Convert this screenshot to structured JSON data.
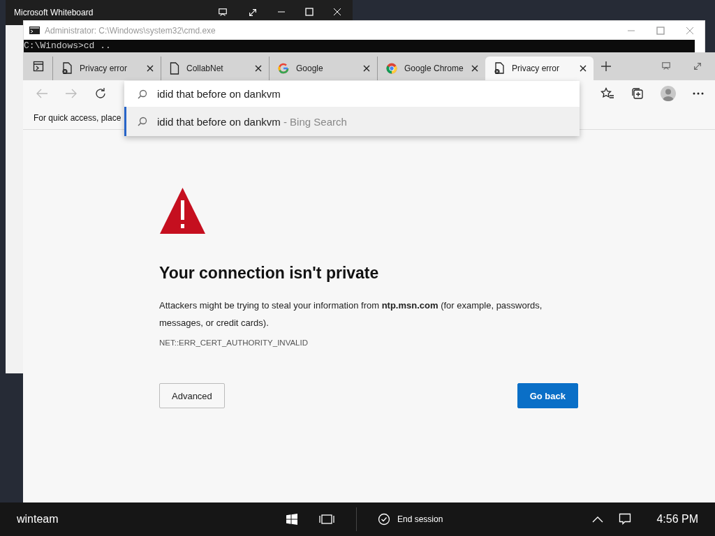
{
  "whiteboard": {
    "title": "Microsoft Whiteboard"
  },
  "cmd": {
    "title": "Administrator: C:\\Windows\\system32\\cmd.exe",
    "lines": [
      "C:\\Windows>cd .."
    ]
  },
  "browser": {
    "tabs": [
      {
        "title": "Privacy error",
        "kind": "error",
        "selected": false
      },
      {
        "title": "CollabNet",
        "kind": "page",
        "selected": false
      },
      {
        "title": "Google",
        "kind": "google",
        "selected": false
      },
      {
        "title": "Google Chrome",
        "kind": "chrome",
        "selected": false
      },
      {
        "title": "Privacy error",
        "kind": "error",
        "selected": true
      }
    ],
    "address": {
      "value": "idid that before on dankvm"
    },
    "suggestions": [
      {
        "query": "idid that before on dankvm",
        "source": "- Bing Search",
        "selected": true
      }
    ],
    "favorites_bar": {
      "text": "For quick access, place"
    },
    "page": {
      "heading": "Your connection isn't private",
      "body": "Attackers might be trying to steal your information from **ntp.msn.com** (for example, passwords, messages, or credit cards).",
      "error_code": "NET::ERR_CERT_AUTHORITY_INVALID",
      "buttons": [
        {
          "label": "Advanced",
          "kind": "secondary"
        },
        {
          "label": "Go back",
          "kind": "primary"
        }
      ]
    }
  },
  "taskbar": {
    "user": "winteam",
    "end_session": "End session",
    "clock": "4:56 PM"
  }
}
